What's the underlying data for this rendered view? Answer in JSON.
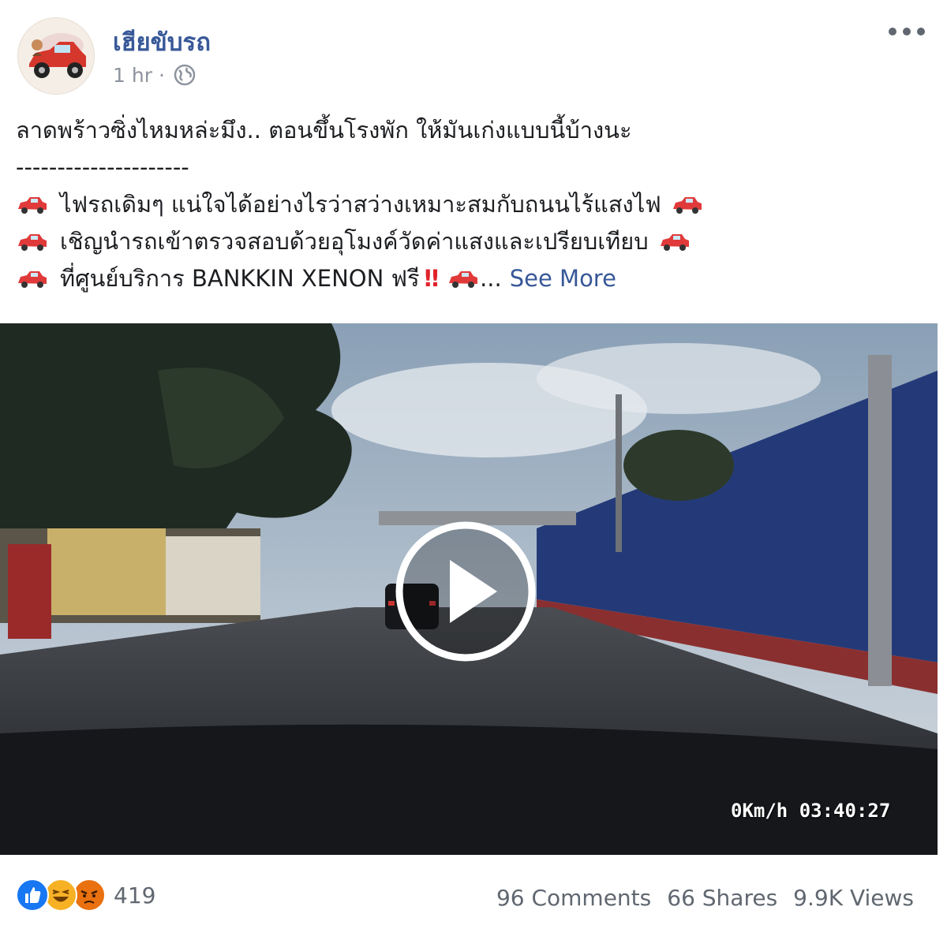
{
  "post": {
    "page_name": "เฮียขับรถ",
    "time": "1 hr",
    "separator": "·",
    "audience_icon": "globe-icon",
    "more_icon": "more-options-icon"
  },
  "content": {
    "line1": "ลาดพร้าวซิ่งไหมหล่ะมึง.. ตอนขึ้นโรงพัก ให้มันเก่งแบบนี้บ้างนะ",
    "line2": "---------------------",
    "line3": "ไฟรถเดิมๆ แน่ใจได้อย่างไรว่าสว่างเหมาะสมกับถนนไร้แสงไฟ",
    "line4": "เชิญนำรถเข้าตรวจสอบด้วยอุโมงค์วัดค่าแสงและเปรียบเทียบ",
    "line5": "ที่ศูนย์บริการ BANKKIN XENON ฟรี",
    "bang": "!!",
    "ellipsis": "...",
    "see_more": "See More",
    "emoji_icon": "red-car-icon"
  },
  "video": {
    "timestamp": "0Km/h 03:40:27",
    "play_icon": "play-icon"
  },
  "footer": {
    "reaction_icons": [
      "like-icon",
      "haha-icon",
      "angry-icon"
    ],
    "reaction_count": "419",
    "comments": "96 Comments",
    "shares": "66 Shares",
    "views": "9.9K Views"
  },
  "colors": {
    "link_blue": "#385898",
    "meta_gray": "#8d949e",
    "stats_gray": "#606770",
    "like_blue": "#1877f2",
    "haha_yellow": "#f7b125",
    "angry_orange": "#e9710f"
  }
}
